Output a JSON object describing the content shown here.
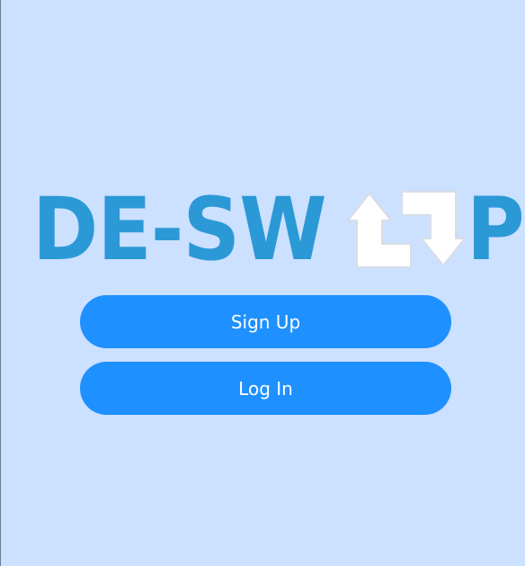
{
  "logo": {
    "text_before_icon": "DE-SW",
    "icon": "swap-arrows-icon",
    "text_after_icon": "P",
    "color": "#2b99d6"
  },
  "buttons": {
    "signup_label": "Sign Up",
    "login_label": "Log In"
  },
  "colors": {
    "background": "#cce0ff",
    "button": "#1e90ff",
    "button_text": "#ffffff"
  }
}
